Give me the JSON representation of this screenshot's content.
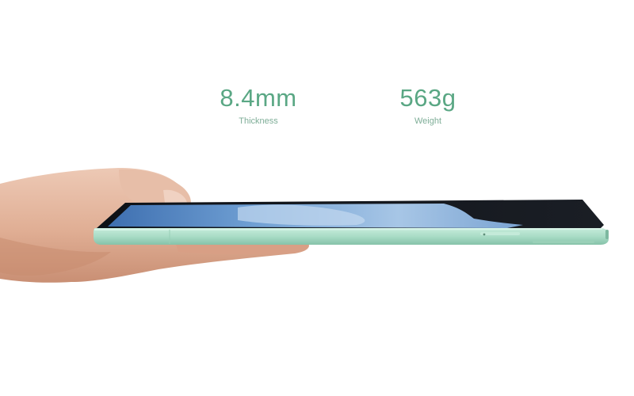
{
  "specs": {
    "thickness": {
      "value": "8.4mm",
      "label": "Thickness"
    },
    "weight": {
      "value": "563g",
      "label": "Weight"
    }
  },
  "colors": {
    "accent_green": "#5aa784",
    "label_green": "#7fae98",
    "tablet_frame": "#a9dcc6",
    "screen_dark": "#12151a",
    "wallpaper_blue": "#5d8fc6",
    "skin": "#e2b49c"
  },
  "scene": {
    "objects": [
      "hand",
      "tablet"
    ]
  }
}
